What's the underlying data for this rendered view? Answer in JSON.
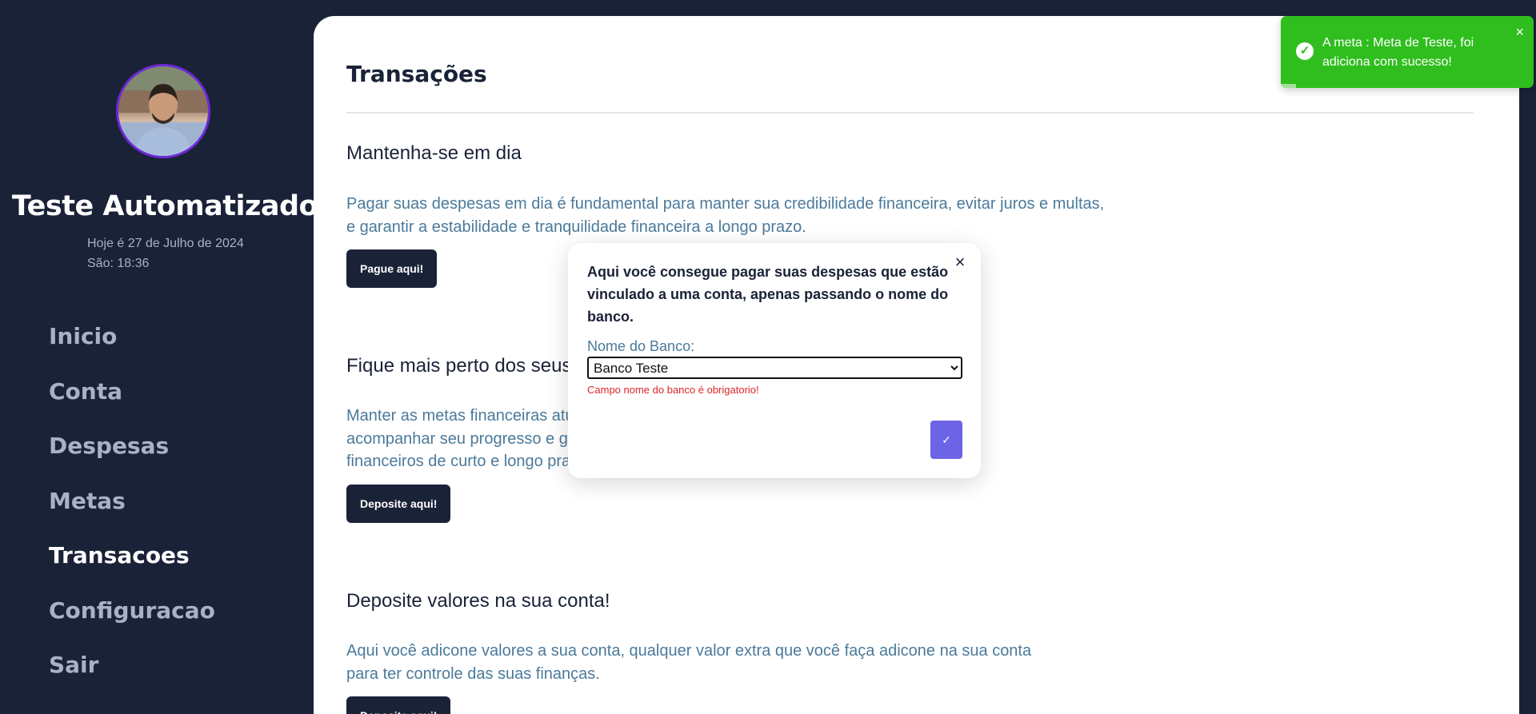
{
  "sidebar": {
    "user_name": "Teste Automatizado",
    "date_line": "Hoje é 27 de Julho de 2024",
    "time_line": "São: 18:36",
    "nav": [
      {
        "label": "Inicio"
      },
      {
        "label": "Conta"
      },
      {
        "label": "Despesas"
      },
      {
        "label": "Metas"
      },
      {
        "label": "Transacoes",
        "active": true
      },
      {
        "label": "Configuracao"
      },
      {
        "label": "Sair"
      }
    ]
  },
  "main": {
    "title": "Transações",
    "sections": [
      {
        "heading": "Mantenha-se em dia",
        "lines": [
          "Pagar suas despesas em dia é fundamental para manter sua credibilidade financeira, evitar juros e multas,",
          "e garantir a estabilidade e tranquilidade financeira a longo prazo."
        ],
        "button": "Pague aqui!"
      },
      {
        "heading": "Fique mais perto dos seus",
        "lines": [
          "Manter as metas financeiras atu",
          "acompanhar seu progresso e ga",
          "financeiros de curto e longo pra"
        ],
        "button": "Deposite aqui!"
      },
      {
        "heading": "Deposite valores na sua conta!",
        "lines": [
          "Aqui você adicone valores a sua conta, qualquer valor extra que você faça adicone na sua conta",
          "para ter controle das suas finanças."
        ],
        "button": "Deposite aqui!"
      }
    ]
  },
  "modal": {
    "lines": [
      "Aqui você consegue pagar suas despesas que estão",
      "vinculado a uma conta, apenas passando o nome do",
      "banco."
    ],
    "field_label": "Nome do Banco:",
    "select_value": "Banco Teste",
    "error": "Campo nome do banco é obrigatorio!",
    "confirm_icon": "check-icon"
  },
  "toast": {
    "lines": [
      "A meta : Meta de Teste, foi",
      "adiciona com sucesso!"
    ],
    "color": "#2fbe1e",
    "progress": 0.06
  },
  "colors": {
    "sidebar_bg": "#1a2238",
    "accent": "#6c63e6",
    "body_text": "#4b7a9b",
    "error": "#dc2626"
  }
}
